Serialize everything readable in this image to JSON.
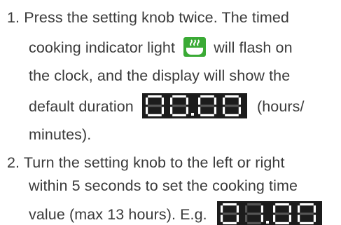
{
  "steps": [
    {
      "number": "1.",
      "lines": [
        "Press the setting knob twice. The timed",
        "cooking indicator light",
        "will flash on",
        "the clock, and the display will show the",
        "default duration",
        "(hours/",
        "minutes)."
      ],
      "icon": "timed-cooking-pot-icon",
      "display": "00.00"
    },
    {
      "number": "2.",
      "lines": [
        "Turn the setting knob to the left or right",
        "within 5 seconds to set the cooking time",
        "value (max 13 hours). E.g."
      ],
      "display": "01.00"
    }
  ],
  "colors": {
    "text": "#3a3a3a",
    "icon_green": "#3aaa35",
    "display_bg": "#1c1c1c",
    "segment_on": "#ffffff",
    "segment_off": "#555555"
  }
}
